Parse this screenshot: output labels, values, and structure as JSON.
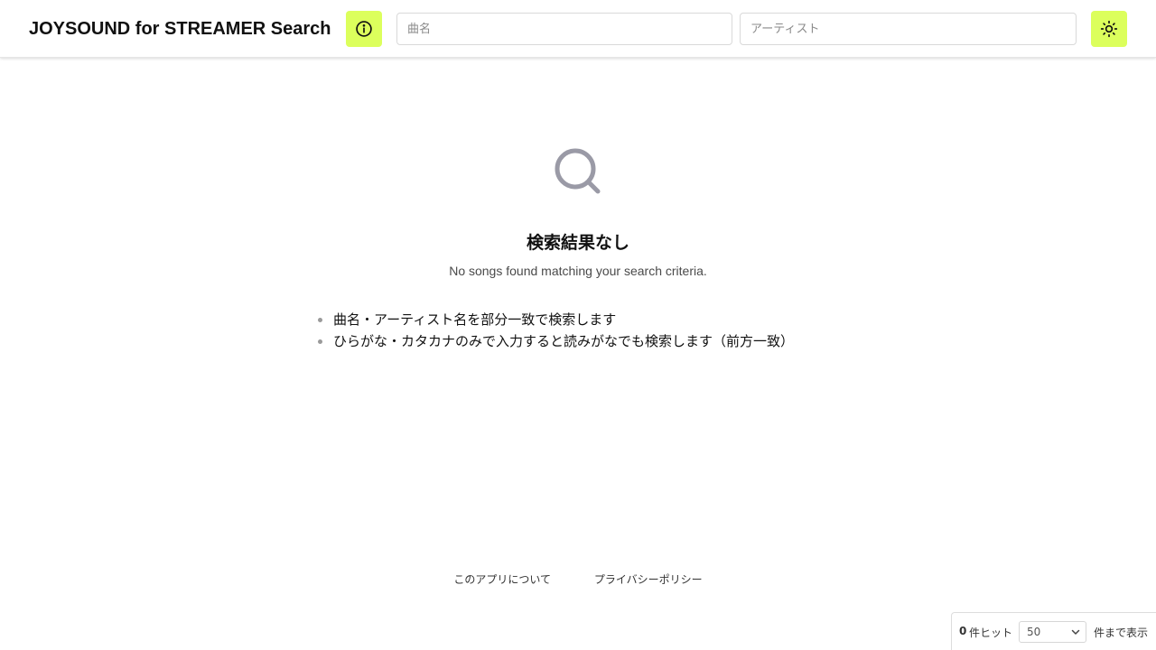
{
  "header": {
    "title": "JOYSOUND for STREAMER Search",
    "info_icon": "info-circle-icon",
    "theme_icon": "sun-icon",
    "song_field": {
      "placeholder": "曲名",
      "value": ""
    },
    "artist_field": {
      "placeholder": "アーティスト",
      "value": ""
    }
  },
  "empty_state": {
    "icon": "search-icon",
    "title": "検索結果なし",
    "subtitle": "No songs found matching your search criteria.",
    "tips": [
      "曲名・アーティスト名を部分一致で検索します",
      "ひらがな・カタカナのみで入力すると読みがなでも検索します（前方一致）"
    ]
  },
  "footer": {
    "links": [
      "このアプリについて",
      "プライバシーポリシー"
    ]
  },
  "result_bar": {
    "count": "0",
    "count_label": "件ヒット",
    "limit_value": "50",
    "limit_suffix": "件まで表示"
  },
  "colors": {
    "accent": "#dcff5c",
    "text": "#111111",
    "muted_icon": "#9a9aa6",
    "border": "#d9d9d9"
  }
}
